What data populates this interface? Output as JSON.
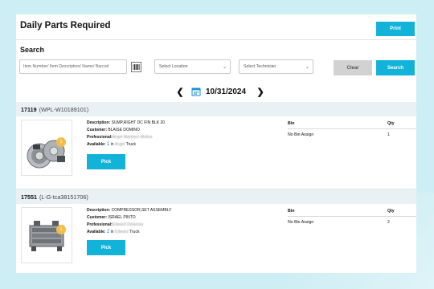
{
  "app": {
    "title": "Daily Parts Required"
  },
  "toolbar": {
    "print_label": "Print"
  },
  "search": {
    "label": "Search",
    "input_placeholder": "Item Number/ Item Description/ Name/ Barcod",
    "location_select": "Select Location",
    "technician_select": "Select Technician",
    "clear_label": "Clear",
    "search_label": "Search"
  },
  "date_nav": {
    "date": "10/31/2024"
  },
  "parts": [
    {
      "number": "17119",
      "code": "(WPL-W10189101)",
      "badge": "1",
      "description_label": "Description:",
      "description": "SUMP,RIGHT DC FIN BLK 20",
      "customer_label": "Customer:",
      "customer": "BLAISE DOMINO",
      "professional_label": "Professional:",
      "professional": "Angel Martinez-Molina",
      "available_label": "Available:",
      "available_qty": "1",
      "available_in": "in",
      "available_loc": "Angel",
      "available_unit": "Truck",
      "pick_label": "Pick",
      "bin_header": "Bin",
      "qty_header": "Qty",
      "bin_value": "No Bin Assign",
      "qty_value": "1"
    },
    {
      "number": "17551",
      "code": "(L-G-tca38151706)",
      "badge": "1",
      "description_label": "Description:",
      "description": "COMPRESSOR,SET ASSEMBLY",
      "customer_label": "Customer:",
      "customer": "ISRAEL PINTO",
      "professional_label": "Professional:",
      "professional": "Edward Delarosa",
      "available_label": "Available:",
      "available_qty": "2",
      "available_in": "in",
      "available_loc": "Edward",
      "available_unit": "Truck",
      "pick_label": "Pick",
      "bin_header": "Bin",
      "qty_header": "Qty",
      "bin_value": "No Bin Assign",
      "qty_value": "2"
    }
  ],
  "colors": {
    "accent": "#12b3d9",
    "badge": "#f2bd4a",
    "card_header": "#e9f1f4",
    "background": "#cdeef4"
  }
}
